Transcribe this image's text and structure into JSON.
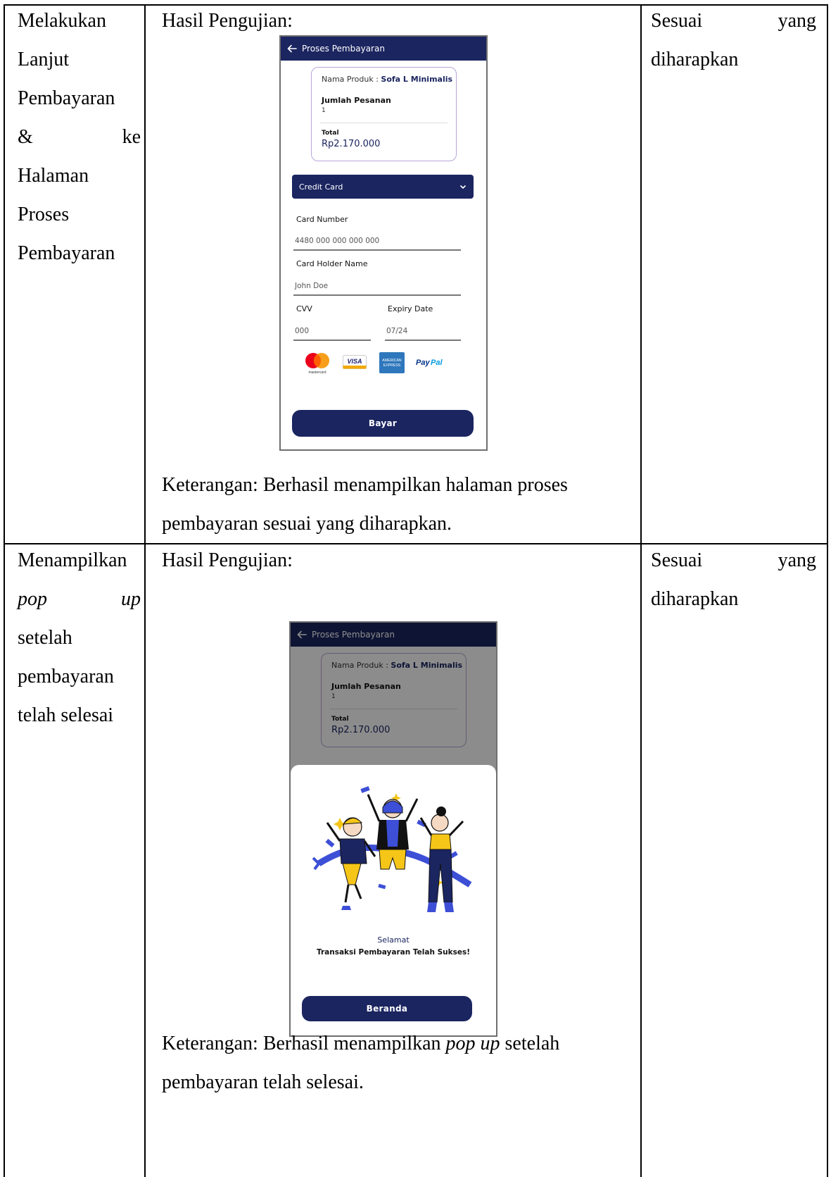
{
  "rows": [
    {
      "col1_lines": [
        "Melakukan",
        "Lanjut",
        "Pembayaran",
        "&",
        "ke",
        "Halaman",
        "Proses",
        "Pembayaran"
      ],
      "result_heading": "Hasil Pengujian:",
      "note_line1": "Keterangan: Berhasil menampilkan halaman proses",
      "note_line2": "pembayaran sesuai yang diharapkan.",
      "status_word1": "Sesuai",
      "status_word2": "yang",
      "status_line2": "diharapkan"
    },
    {
      "col1_word1": "Menampilkan",
      "col1_pop": "pop",
      "col1_up": "up",
      "col1_lines": [
        "setelah",
        "pembayaran",
        "telah selesai"
      ],
      "result_heading": "Hasil Pengujian:",
      "note_prefix": "Keterangan: Berhasil menampilkan ",
      "note_italic": "pop up",
      "note_suffix": " setelah",
      "note_line2": "pembayaran telah selesai.",
      "status_word1": "Sesuai",
      "status_word2": "yang",
      "status_line2": "diharapkan"
    }
  ],
  "app": {
    "appbar_title": "Proses Pembayaran",
    "product_label": "Nama Produk : ",
    "product_name": "Sofa L Minimalis",
    "qty_label": "Jumlah Pesanan",
    "qty_value": "1",
    "total_label": "Total",
    "total_value": "Rp2.170.000",
    "payment_method": "Credit Card",
    "card_number_label": "Card Number",
    "card_number_placeholder": "4480 000 000 000 000",
    "holder_label": "Card Holder Name",
    "holder_placeholder": "John Doe",
    "cvv_label": "CVV",
    "cvv_placeholder": "000",
    "expiry_label": "Expiry Date",
    "expiry_placeholder": "07/24",
    "card_logos": [
      "mastercard",
      "VISA",
      "AMERICAN EXPRESS",
      "PayPal"
    ],
    "pay_button": "Bayar",
    "popup_title": "Selamat",
    "popup_message": "Transaksi Pembayaran Telah Sukses!",
    "home_button": "Beranda"
  },
  "colors": {
    "primary": "#1b2560",
    "accent_yellow": "#f5c518",
    "accent_blue": "#3d4fd6"
  }
}
